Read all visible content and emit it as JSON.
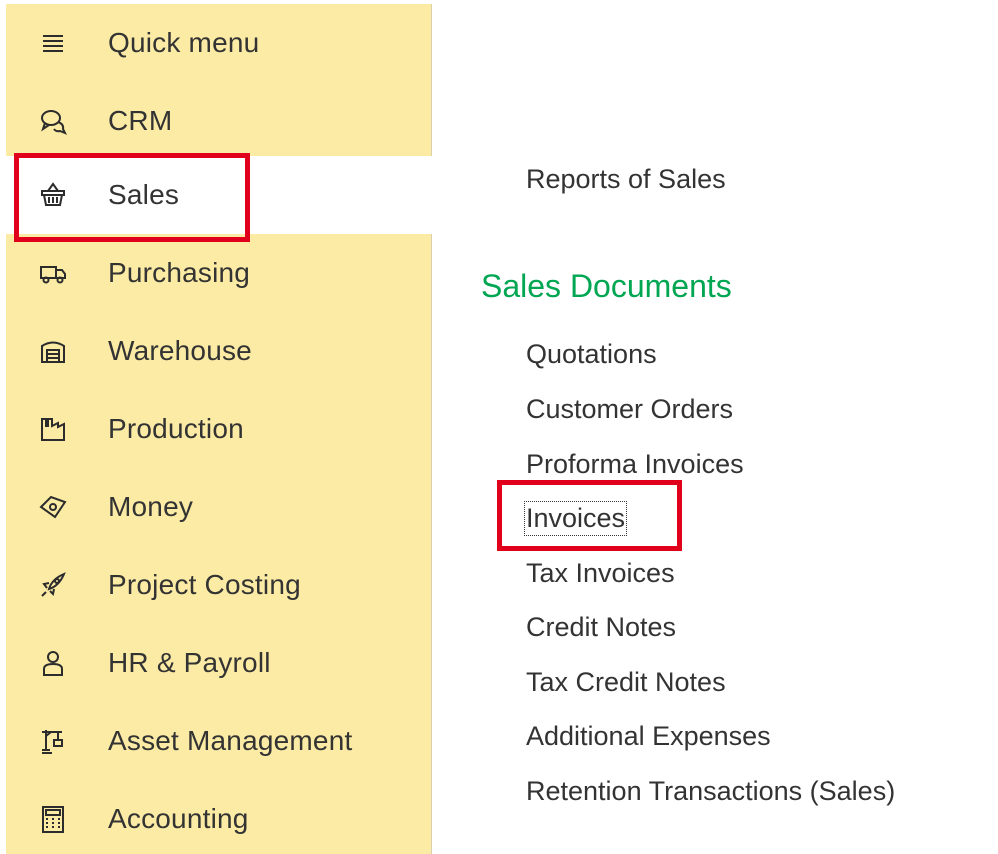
{
  "sidebar": {
    "items": [
      {
        "label": "Quick menu",
        "icon": "menu-lines-icon"
      },
      {
        "label": "CRM",
        "icon": "chat-bubbles-icon"
      },
      {
        "label": "Sales",
        "icon": "basket-icon",
        "active": true
      },
      {
        "label": "Purchasing",
        "icon": "truck-icon"
      },
      {
        "label": "Warehouse",
        "icon": "warehouse-icon"
      },
      {
        "label": "Production",
        "icon": "factory-icon"
      },
      {
        "label": "Money",
        "icon": "money-tag-icon"
      },
      {
        "label": "Project Costing",
        "icon": "rocket-icon"
      },
      {
        "label": "HR & Payroll",
        "icon": "person-icon"
      },
      {
        "label": "Asset Management",
        "icon": "crane-icon"
      },
      {
        "label": "Accounting",
        "icon": "calculator-icon"
      }
    ]
  },
  "main": {
    "reports_link": "Reports of Sales",
    "section_title": "Sales Documents",
    "documents": [
      "Quotations",
      "Customer Orders",
      "Proforma Invoices",
      "Invoices",
      "Tax Invoices",
      "Credit Notes",
      "Tax Credit Notes",
      "Additional Expenses",
      "Retention Transactions (Sales)"
    ]
  },
  "colors": {
    "sidebar_bg": "#fbeba5",
    "section_title": "#00a651",
    "highlight": "#e0001b",
    "text": "#333333"
  }
}
